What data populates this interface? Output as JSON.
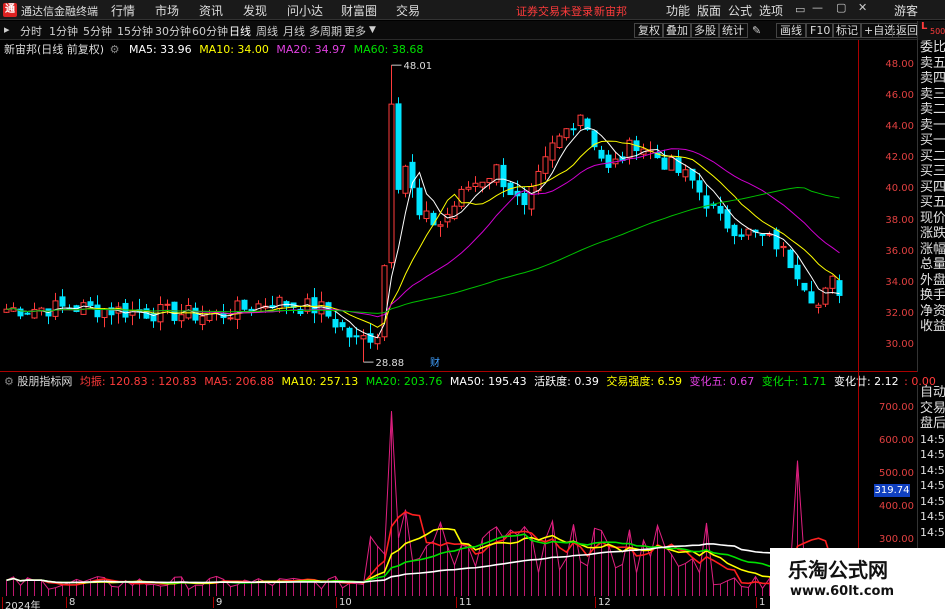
{
  "menubar": {
    "app_title": "通达信金融终端",
    "items": [
      "行情",
      "市场",
      "资讯",
      "发现",
      "问小达",
      "财富圈",
      "交易"
    ],
    "login_status": "证券交易未登录",
    "stock": "新宙邦",
    "right_items": [
      "功能",
      "版面",
      "公式",
      "选项"
    ],
    "guest": "游客"
  },
  "toolbar": {
    "periods": [
      "分时",
      "1分钟",
      "5分钟",
      "15分钟",
      "30分钟",
      "60分钟",
      "日线",
      "周线",
      "月线",
      "多周期",
      "更多"
    ],
    "active_period": "日线",
    "right_buttons": [
      "复权",
      "叠加",
      "多股",
      "统计",
      "画线",
      "F10",
      "标记",
      "+自选",
      "返回"
    ]
  },
  "main_legend": {
    "title": "新宙邦(日线 前复权)",
    "ma5": "MA5: 33.96",
    "ma10": "MA10: 34.00",
    "ma20": "MA20: 34.97",
    "ma60": "MA60: 38.68"
  },
  "price_axis": [
    "48.00",
    "46.00",
    "44.00",
    "42.00",
    "40.00",
    "38.00",
    "36.00",
    "34.00",
    "32.00",
    "30.00"
  ],
  "annotations": {
    "high": "48.01",
    "low": "28.88",
    "finance_marker": "财"
  },
  "right_panel_top": [
    "委比",
    "卖五",
    "卖四",
    "卖三",
    "卖二",
    "卖一",
    "买一",
    "买二",
    "买三",
    "买四",
    "买五",
    "现价",
    "涨跌",
    "涨幅",
    "总量",
    "外盘",
    "换手",
    "净资",
    "收益"
  ],
  "right_panel_bottom": [
    "自动",
    "交易",
    "盘后",
    "14:56",
    "14:56",
    "14:56",
    "14:56",
    "14:56",
    "14:56",
    "14:56"
  ],
  "indicator_legend": {
    "name": "股朋指标网",
    "junzhen": "均振: 120.83 : 120.83",
    "ma5": "MA5: 206.88",
    "ma10": "MA10: 257.13",
    "ma20": "MA20: 203.76",
    "ma50": "MA50: 195.43",
    "huoyue": "活跃度: 0.39",
    "qiangdu": "交易强度: 6.59",
    "bianhua5": "变化五: 0.67",
    "bianhua10": "变化十: 1.71",
    "bianhua20": "变化廿: 2.12",
    "tail": ": 0.00"
  },
  "indicator_axis": [
    "700.00",
    "600.00",
    "500.00",
    "400.00",
    "300.00",
    "200.00"
  ],
  "indicator_current": "319.74",
  "x_axis": [
    "2024年",
    "8",
    "9",
    "10",
    "11",
    "12",
    "1"
  ],
  "watermark": {
    "line1": "乐淘公式网",
    "line2": "www.60lt.com"
  },
  "colors": {
    "up": "#ff3b3b",
    "down": "#00e5ff",
    "ma5": "#ffffff",
    "ma10": "#ffff00",
    "ma20": "#d000d0",
    "ma60": "#00c000"
  }
}
